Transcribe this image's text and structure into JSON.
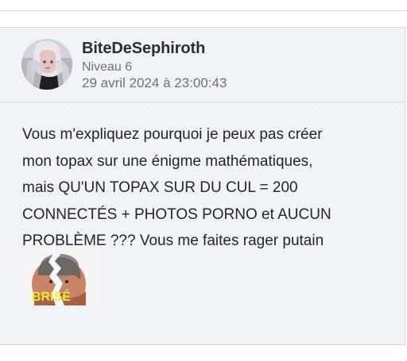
{
  "post": {
    "author": "BiteDeSephiroth",
    "level": "Niveau 6",
    "date": "29 avril 2024 à 23:00:43",
    "message_lines": [
      "Vous m'expliquez pourquoi je peux pas créer",
      "mon topax sur une énigme mathématiques,",
      "mais QU'UN TOPAX SUR DU CUL = 200",
      "CONNECTÉS + PHOTOS PORNO et AUCUN",
      "PROBLÈME ??? Vous me faites rager putain"
    ],
    "sticker_text": "BRISÉ"
  }
}
